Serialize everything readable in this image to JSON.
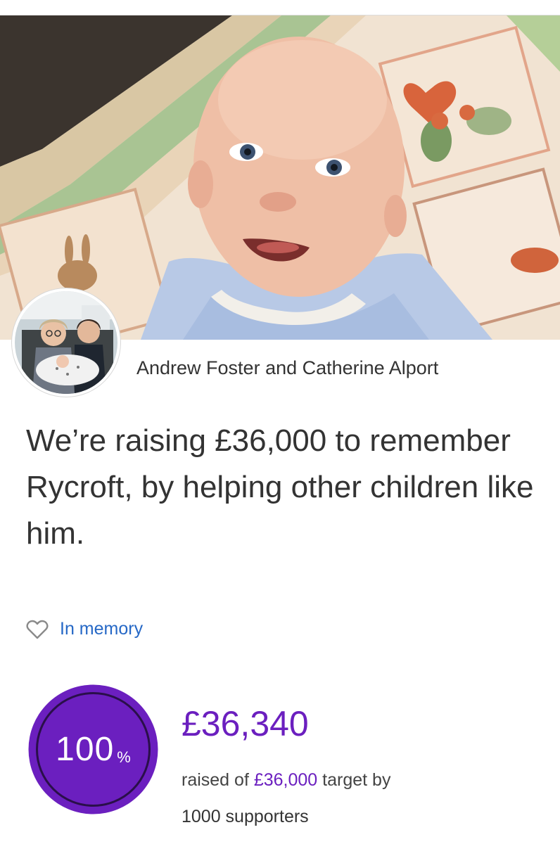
{
  "fundraiser": {
    "organisers": "Andrew Foster and Catherine Alport",
    "headline": "We’re raising £36,000 to remember Rycroft, by helping other children like him.",
    "category_label": "In memory",
    "category_icon": "heart-outline-icon"
  },
  "progress": {
    "percent_number": "100",
    "percent_sign": "%",
    "fraction": 1.0,
    "raised_amount": "£36,340",
    "raised_prefix": "raised of ",
    "target_amount": "£36,000",
    "target_suffix": " target by",
    "supporters": "1000 supporters"
  },
  "colors": {
    "brand_purple": "#6b1fbf",
    "link_blue": "#2668c6",
    "text_dark": "#333333"
  }
}
